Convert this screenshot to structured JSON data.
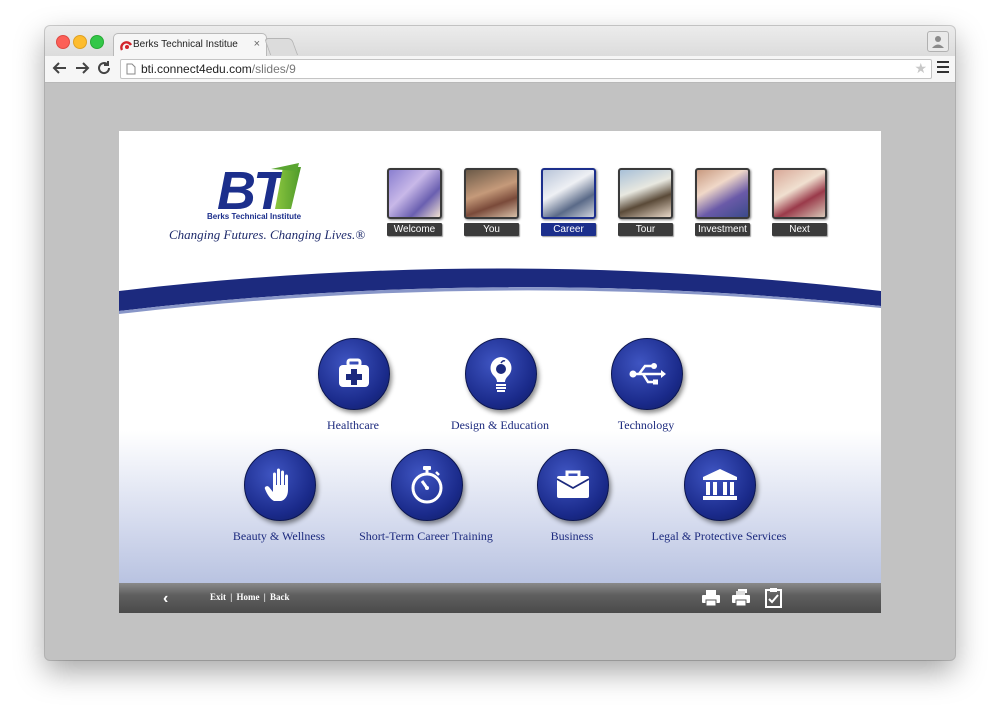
{
  "browser": {
    "tab_title": "Berks Technical Institue",
    "tab_close": "×",
    "url_host": "bti.connect4edu.com",
    "url_path": "/slides/9",
    "star": "★"
  },
  "header": {
    "logo_text": "BTi",
    "logo_subtitle": "Berks Technical Institute",
    "tagline": "Changing Futures. Changing Lives.®",
    "brand_colors": {
      "blue": "#1c2f8c",
      "green": "#5aa531"
    }
  },
  "nav": [
    {
      "label": "Welcome",
      "active": false
    },
    {
      "label": "You",
      "active": false
    },
    {
      "label": "Career",
      "active": true
    },
    {
      "label": "Tour",
      "active": false
    },
    {
      "label": "Investment",
      "active": false
    },
    {
      "label": "Next",
      "active": false
    }
  ],
  "categories": [
    {
      "label": "Healthcare",
      "icon": "medical-kit-icon"
    },
    {
      "label": "Design & Education",
      "icon": "lightbulb-apple-icon"
    },
    {
      "label": "Technology",
      "icon": "usb-icon"
    },
    {
      "label": "Beauty & Wellness",
      "icon": "hand-icon"
    },
    {
      "label": "Short-Term Career Training",
      "icon": "stopwatch-icon"
    },
    {
      "label": "Business",
      "icon": "briefcase-icon"
    },
    {
      "label": "Legal & Protective Services",
      "icon": "courthouse-icon"
    }
  ],
  "footer": {
    "back_arrow": "‹",
    "exit": "Exit",
    "home": "Home",
    "back": "Back",
    "sep1": "|",
    "sep2": "|",
    "icons": [
      "printer-icon",
      "print-all-icon",
      "checklist-icon"
    ]
  }
}
